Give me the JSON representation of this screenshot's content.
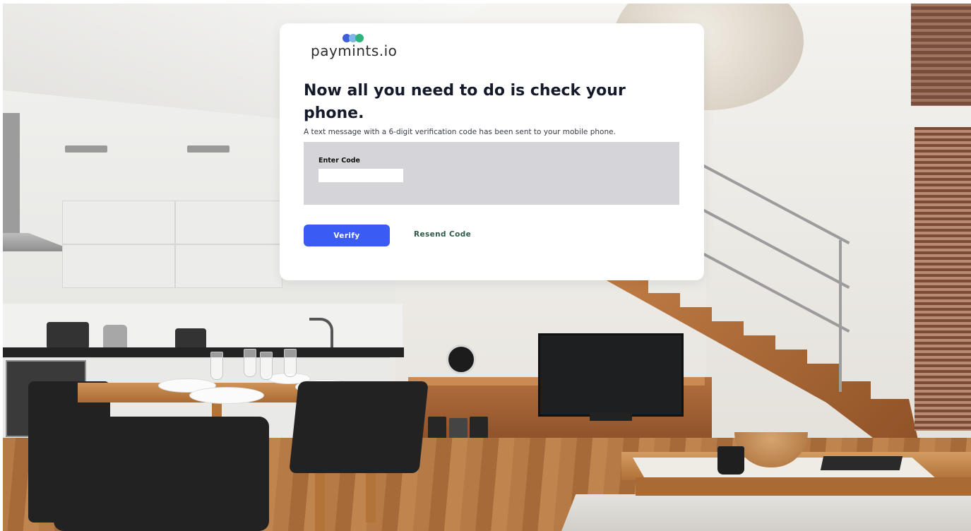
{
  "brand": {
    "name": "paymints.io",
    "colors": [
      "#3f5fd8",
      "#7fb6e9",
      "#2fb37a"
    ]
  },
  "verification": {
    "heading": "Now all you need to do is check your phone.",
    "description": "A text message with a 6-digit verification code has been sent to your mobile phone.",
    "code_label": "Enter Code",
    "code_value": "",
    "code_placeholder": ""
  },
  "actions": {
    "verify_label": "Verify",
    "resend_label": "Resend Code"
  },
  "theme": {
    "primary": "#3b5bf5",
    "link": "#2d5b45",
    "panel": "#d4d4d9"
  }
}
